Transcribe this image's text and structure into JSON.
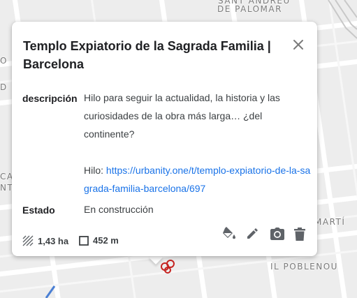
{
  "map": {
    "labels": [
      {
        "text": "SANT ANDREU",
        "cls": "l1"
      },
      {
        "text": "DE PALOMAR",
        "cls": "l2"
      },
      {
        "text": "IL POBLENOU",
        "cls": "l3"
      },
      {
        "text": "MARTÍ",
        "cls": "l4"
      }
    ]
  },
  "popup": {
    "title": "Templo Expiatorio de la Sagrada Familia | Barcelona",
    "properties": {
      "description_key": "descripción",
      "description_text": "Hilo para seguir la actualidad, la historia y las curiosidades de la obra más larga… ¿del continente?",
      "thread_prefix": "Hilo: ",
      "thread_link": "https://urbanity.one/t/templo-expiatorio-de-la-sagrada-familia-barcelona/697",
      "status_key": "Estado",
      "status_value": "En construcción"
    },
    "measurements": {
      "area": "1,43 ha",
      "perimeter": "452 m"
    },
    "icons": {
      "close": "close-icon",
      "area": "area-hatch-icon",
      "perimeter": "square-outline-icon",
      "style": "paint-bucket-icon",
      "edit": "pencil-icon",
      "photo": "camera-icon",
      "delete": "trash-icon"
    }
  }
}
